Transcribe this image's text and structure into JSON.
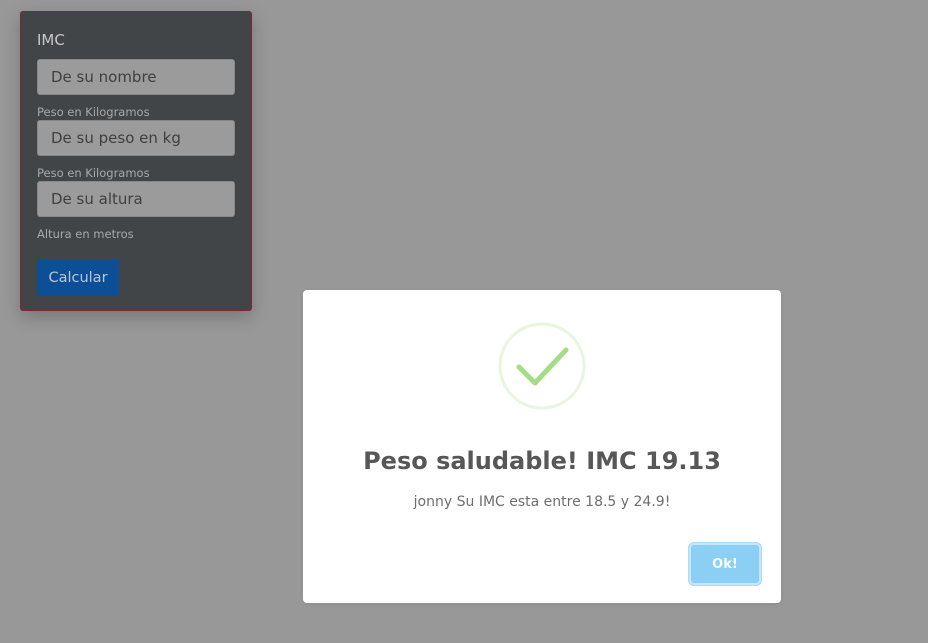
{
  "form": {
    "title": "IMC",
    "name_placeholder": "De su nombre",
    "name_help": "Peso en Kilogramos",
    "weight_placeholder": "De su peso en kg",
    "weight_help": "Peso en Kilogramos",
    "height_placeholder": "De su altura",
    "height_help": "Altura en metros",
    "submit_label": "Calcular"
  },
  "dialog": {
    "icon": "check-icon",
    "title": "Peso saludable! IMC 19.13",
    "message": "jonny Su IMC esta entre 18.5 y 24.9!",
    "confirm_label": "Ok!"
  },
  "colors": {
    "overlay": "#989898",
    "card_background": "#424547",
    "submit_button": "#0c4f96",
    "success_green": "#a5dc86",
    "ok_button": "#8ccff5"
  }
}
